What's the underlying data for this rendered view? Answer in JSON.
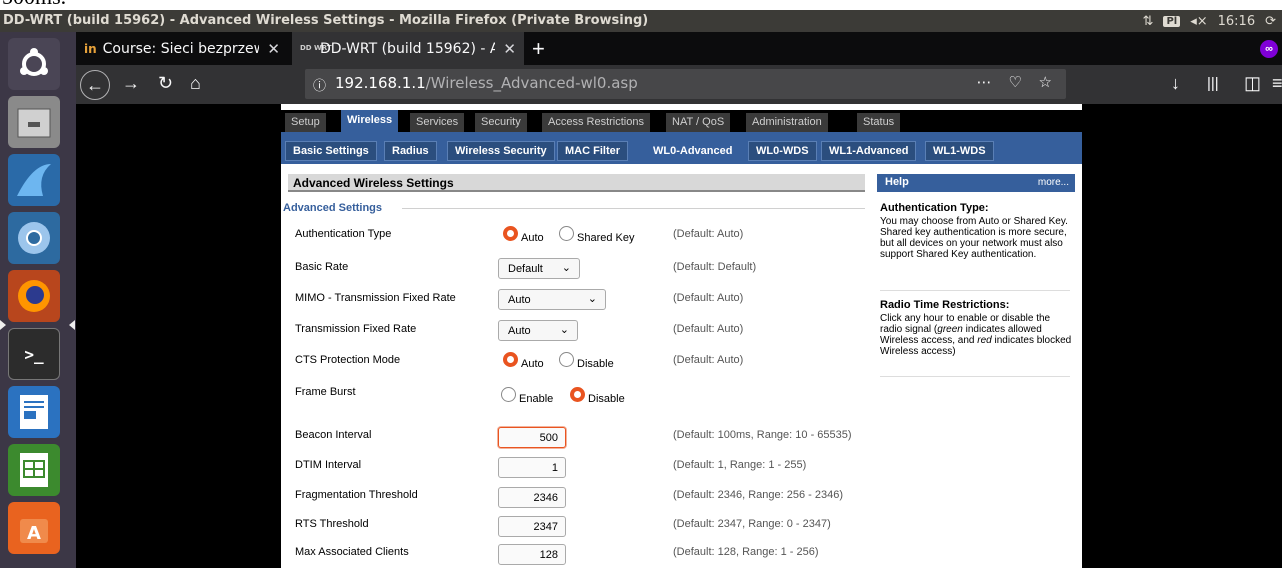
{
  "cutoff_text": "500ms.",
  "window": {
    "title": "DD-WRT (build 15962) - Advanced Wireless Settings - Mozilla Firefox (Private Browsing)",
    "time": "16:16",
    "kb": "Pl"
  },
  "tabs": [
    {
      "label": "Course: Sieci bezprzewo",
      "favicon": "in"
    },
    {
      "label": "DD-WRT (build 15962) - A",
      "favicon": "DD WRT"
    }
  ],
  "url": {
    "host": "192.168.1.1",
    "path": "/Wireless_Advanced-wl0.asp"
  },
  "main_nav": [
    "Setup",
    "Wireless",
    "Services",
    "Security",
    "Access Restrictions",
    "NAT / QoS",
    "Administration",
    "Status"
  ],
  "main_nav_active": "Wireless",
  "sub_nav": [
    "Basic Settings",
    "Radius",
    "Wireless Security",
    "MAC Filter",
    "WL0-Advanced",
    "WL0-WDS",
    "WL1-Advanced",
    "WL1-WDS"
  ],
  "sub_nav_active": "WL0-Advanced",
  "section_title": "Advanced Wireless Settings",
  "legend": "Advanced Settings",
  "settings": {
    "auth": {
      "label": "Authentication Type",
      "opt1": "Auto",
      "opt2": "Shared Key",
      "default": "(Default: Auto)"
    },
    "basic_rate": {
      "label": "Basic Rate",
      "value": "Default",
      "default": "(Default: Default)"
    },
    "mimo": {
      "label": "MIMO - Transmission Fixed Rate",
      "value": "Auto",
      "default": "(Default: Auto)"
    },
    "tx_rate": {
      "label": "Transmission Fixed Rate",
      "value": "Auto",
      "default": "(Default: Auto)"
    },
    "cts": {
      "label": "CTS Protection Mode",
      "opt1": "Auto",
      "opt2": "Disable",
      "default": "(Default: Auto)"
    },
    "frame": {
      "label": "Frame Burst",
      "opt1": "Enable",
      "opt2": "Disable"
    },
    "beacon": {
      "label": "Beacon Interval",
      "value": "500",
      "default": "(Default: 100ms, Range: 10 - 65535)"
    },
    "dtim": {
      "label": "DTIM Interval",
      "value": "1",
      "default": "(Default: 1, Range: 1 - 255)"
    },
    "frag": {
      "label": "Fragmentation Threshold",
      "value": "2346",
      "default": "(Default: 2346, Range: 256 - 2346)"
    },
    "rts": {
      "label": "RTS Threshold",
      "value": "2347",
      "default": "(Default: 2347, Range: 0 - 2347)"
    },
    "max_clients": {
      "label": "Max Associated Clients",
      "value": "128",
      "default": "(Default: 128, Range: 1 - 256)"
    }
  },
  "help": {
    "title": "Help",
    "more": "more...",
    "auth_title": "Authentication Type:",
    "auth_text": "You may choose from Auto or Shared Key. Shared key authentication is more secure, but all devices on your network must also support Shared Key authentication.",
    "radio_title": "Radio Time Restrictions:",
    "radio_text_1": "Click any hour to enable or disable the radio signal (",
    "radio_green": "green",
    "radio_text_2": " indicates allowed Wireless access, and ",
    "radio_red": "red",
    "radio_text_3": " indicates blocked Wireless access)"
  },
  "colors": {
    "accent": "#365f9c",
    "radio": "#e95420"
  }
}
